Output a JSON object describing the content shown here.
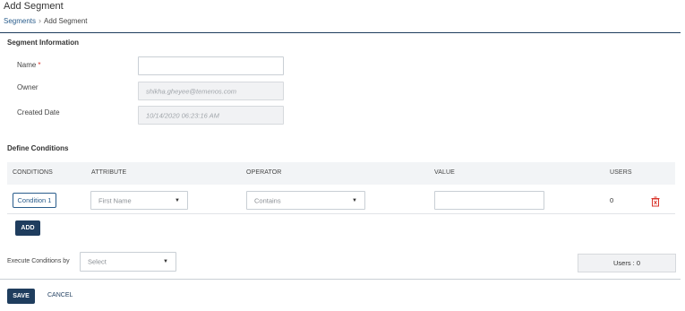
{
  "header": {
    "title": "Add Segment",
    "breadcrumb": {
      "parent": "Segments",
      "separator": "›",
      "current": "Add Segment"
    }
  },
  "segment_info": {
    "section_title": "Segment Information",
    "name_label": "Name",
    "name_required_mark": "*",
    "name_value": "",
    "owner_label": "Owner",
    "owner_value": "shikha.gheyee@temenos.com",
    "created_label": "Created Date",
    "created_value": "10/14/2020 06:23:16 AM"
  },
  "conditions": {
    "section_title": "Define Conditions",
    "columns": [
      "CONDITIONS",
      "ATTRIBUTE",
      "OPERATOR",
      "VALUE",
      "USERS"
    ],
    "rows": [
      {
        "condition": "Condition 1",
        "attribute": "First Name",
        "operator": "Contains",
        "value": "",
        "users": "0"
      }
    ],
    "add_label": "ADD"
  },
  "execute": {
    "label": "Execute Conditions by",
    "placeholder": "Select",
    "users_summary": "Users : 0"
  },
  "footer": {
    "save_label": "SAVE",
    "cancel_label": "CANCEL"
  },
  "icons": {
    "dropdown": "chevron-down-icon",
    "delete": "trash-icon"
  },
  "colors": {
    "primary": "#1f3d5e",
    "link": "#2a5d8c",
    "danger": "#d9342b"
  }
}
